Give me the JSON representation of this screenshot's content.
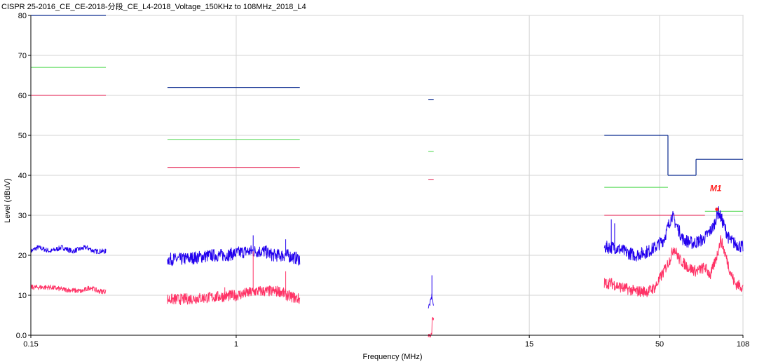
{
  "chart_data": {
    "type": "line",
    "title": "CISPR 25-2016_CE_CE-2018-分段_CE_L4-2018_Voltage_150KHz to 108MHz_2018_L4",
    "xlabel": "Frequency (MHz)",
    "ylabel": "Level (dBuV)",
    "xscale": "log",
    "xlim": [
      0.15,
      108
    ],
    "ylim": [
      0,
      80
    ],
    "x_ticks": [
      {
        "value": 0.15,
        "label": "0.15"
      },
      {
        "value": 1,
        "label": "1"
      },
      {
        "value": 15,
        "label": "15"
      },
      {
        "value": 50,
        "label": "50"
      },
      {
        "value": 108,
        "label": "108"
      }
    ],
    "y_ticks": [
      {
        "value": 0,
        "label": "0.0"
      },
      {
        "value": 10,
        "label": "10"
      },
      {
        "value": 20,
        "label": "20"
      },
      {
        "value": 30,
        "label": "30"
      },
      {
        "value": 40,
        "label": "40"
      },
      {
        "value": 50,
        "label": "50"
      },
      {
        "value": 60,
        "label": "60"
      },
      {
        "value": 70,
        "label": "70"
      },
      {
        "value": 80,
        "label": "80"
      }
    ],
    "grid": true,
    "colors": {
      "peak_limit": "#0a2a8f",
      "qp_limit": "#66dd66",
      "avg_limit": "#e8406a",
      "peak_trace": "#2200ee",
      "avg_trace": "#ff3366",
      "marker": "#ff2222"
    },
    "limit_lines": [
      {
        "name": "peak",
        "color": "#0a2a8f",
        "segments": [
          [
            0.15,
            0.3,
            80
          ],
          [
            0.53,
            1.8,
            62
          ],
          [
            5.9,
            6.2,
            59
          ],
          [
            30,
            54,
            50
          ],
          [
            54,
            70,
            40
          ],
          [
            70,
            108,
            44
          ]
        ]
      },
      {
        "name": "qp",
        "color": "#66dd66",
        "segments": [
          [
            0.15,
            0.3,
            67
          ],
          [
            0.53,
            1.8,
            49
          ],
          [
            5.9,
            6.2,
            46
          ],
          [
            30,
            54,
            37
          ],
          [
            76,
            108,
            31
          ]
        ]
      },
      {
        "name": "avg",
        "color": "#e8406a",
        "segments": [
          [
            0.15,
            0.3,
            60
          ],
          [
            0.53,
            1.8,
            42
          ],
          [
            5.9,
            6.2,
            39
          ],
          [
            30,
            76,
            30
          ]
        ]
      }
    ],
    "series": [
      {
        "trace": "peak",
        "color": "#2200ee",
        "segments": [
          {
            "x_range": [
              0.15,
              0.3
            ],
            "points": [
              [
                0.15,
                21
              ],
              [
                0.16,
                22
              ],
              [
                0.18,
                21
              ],
              [
                0.2,
                22
              ],
              [
                0.22,
                21
              ],
              [
                0.25,
                22
              ],
              [
                0.27,
                21
              ],
              [
                0.3,
                21
              ]
            ]
          },
          {
            "x_range": [
              0.53,
              1.8
            ],
            "points": [
              [
                0.53,
                19
              ],
              [
                0.6,
                19
              ],
              [
                0.7,
                19.5
              ],
              [
                0.8,
                20
              ],
              [
                0.9,
                20
              ],
              [
                1.0,
                20.5
              ],
              [
                1.1,
                21
              ],
              [
                1.2,
                21
              ],
              [
                1.3,
                21
              ],
              [
                1.4,
                20
              ],
              [
                1.5,
                20
              ],
              [
                1.6,
                20
              ],
              [
                1.8,
                19
              ]
            ],
            "spikes": [
              [
                1.17,
                25
              ],
              [
                1.58,
                24
              ]
            ]
          },
          {
            "x_range": [
              5.9,
              6.2
            ],
            "points": [
              [
                5.9,
                7
              ],
              [
                6.0,
                8
              ],
              [
                6.1,
                10
              ],
              [
                6.2,
                7
              ]
            ],
            "spikes": [
              [
                6.1,
                15
              ]
            ]
          },
          {
            "x_range": [
              30,
              108
            ],
            "points": [
              [
                30,
                22
              ],
              [
                33,
                22
              ],
              [
                36,
                21
              ],
              [
                40,
                20
              ],
              [
                45,
                21
              ],
              [
                48,
                22
              ],
              [
                52,
                24
              ],
              [
                56,
                30
              ],
              [
                58,
                28
              ],
              [
                62,
                24
              ],
              [
                68,
                23
              ],
              [
                75,
                24
              ],
              [
                82,
                27
              ],
              [
                86,
                31
              ],
              [
                90,
                28
              ],
              [
                95,
                24
              ],
              [
                100,
                23
              ],
              [
                108,
                22
              ]
            ],
            "spikes": [
              [
                32,
                29
              ],
              [
                33,
                28
              ]
            ]
          }
        ]
      },
      {
        "trace": "avg",
        "color": "#ff3366",
        "segments": [
          {
            "x_range": [
              0.15,
              0.3
            ],
            "points": [
              [
                0.15,
                12
              ],
              [
                0.18,
                12
              ],
              [
                0.2,
                11.5
              ],
              [
                0.24,
                11
              ],
              [
                0.26,
                12
              ],
              [
                0.28,
                11
              ],
              [
                0.3,
                11
              ]
            ]
          },
          {
            "x_range": [
              0.53,
              1.8
            ],
            "points": [
              [
                0.53,
                9
              ],
              [
                0.6,
                9
              ],
              [
                0.8,
                9.5
              ],
              [
                1.0,
                10
              ],
              [
                1.2,
                11
              ],
              [
                1.5,
                11
              ],
              [
                1.6,
                10
              ],
              [
                1.8,
                9
              ]
            ],
            "spikes": [
              [
                0.9,
                12
              ],
              [
                1.17,
                21
              ],
              [
                1.58,
                16
              ]
            ]
          },
          {
            "x_range": [
              5.9,
              6.2
            ],
            "points": [
              [
                6.1,
                0
              ],
              [
                6.1,
                4
              ]
            ]
          },
          {
            "x_range": [
              30,
              108
            ],
            "points": [
              [
                30,
                13
              ],
              [
                32,
                13
              ],
              [
                35,
                12
              ],
              [
                40,
                11
              ],
              [
                45,
                11
              ],
              [
                48,
                12
              ],
              [
                52,
                16
              ],
              [
                55,
                19
              ],
              [
                57,
                22
              ],
              [
                60,
                19
              ],
              [
                65,
                17
              ],
              [
                70,
                16
              ],
              [
                76,
                17
              ],
              [
                80,
                15
              ],
              [
                85,
                20
              ],
              [
                88,
                24
              ],
              [
                92,
                20
              ],
              [
                96,
                16
              ],
              [
                100,
                13
              ],
              [
                108,
                12
              ]
            ]
          }
        ]
      }
    ],
    "markers": [
      {
        "label": "M1",
        "x": 86,
        "y": 31.5
      }
    ]
  }
}
